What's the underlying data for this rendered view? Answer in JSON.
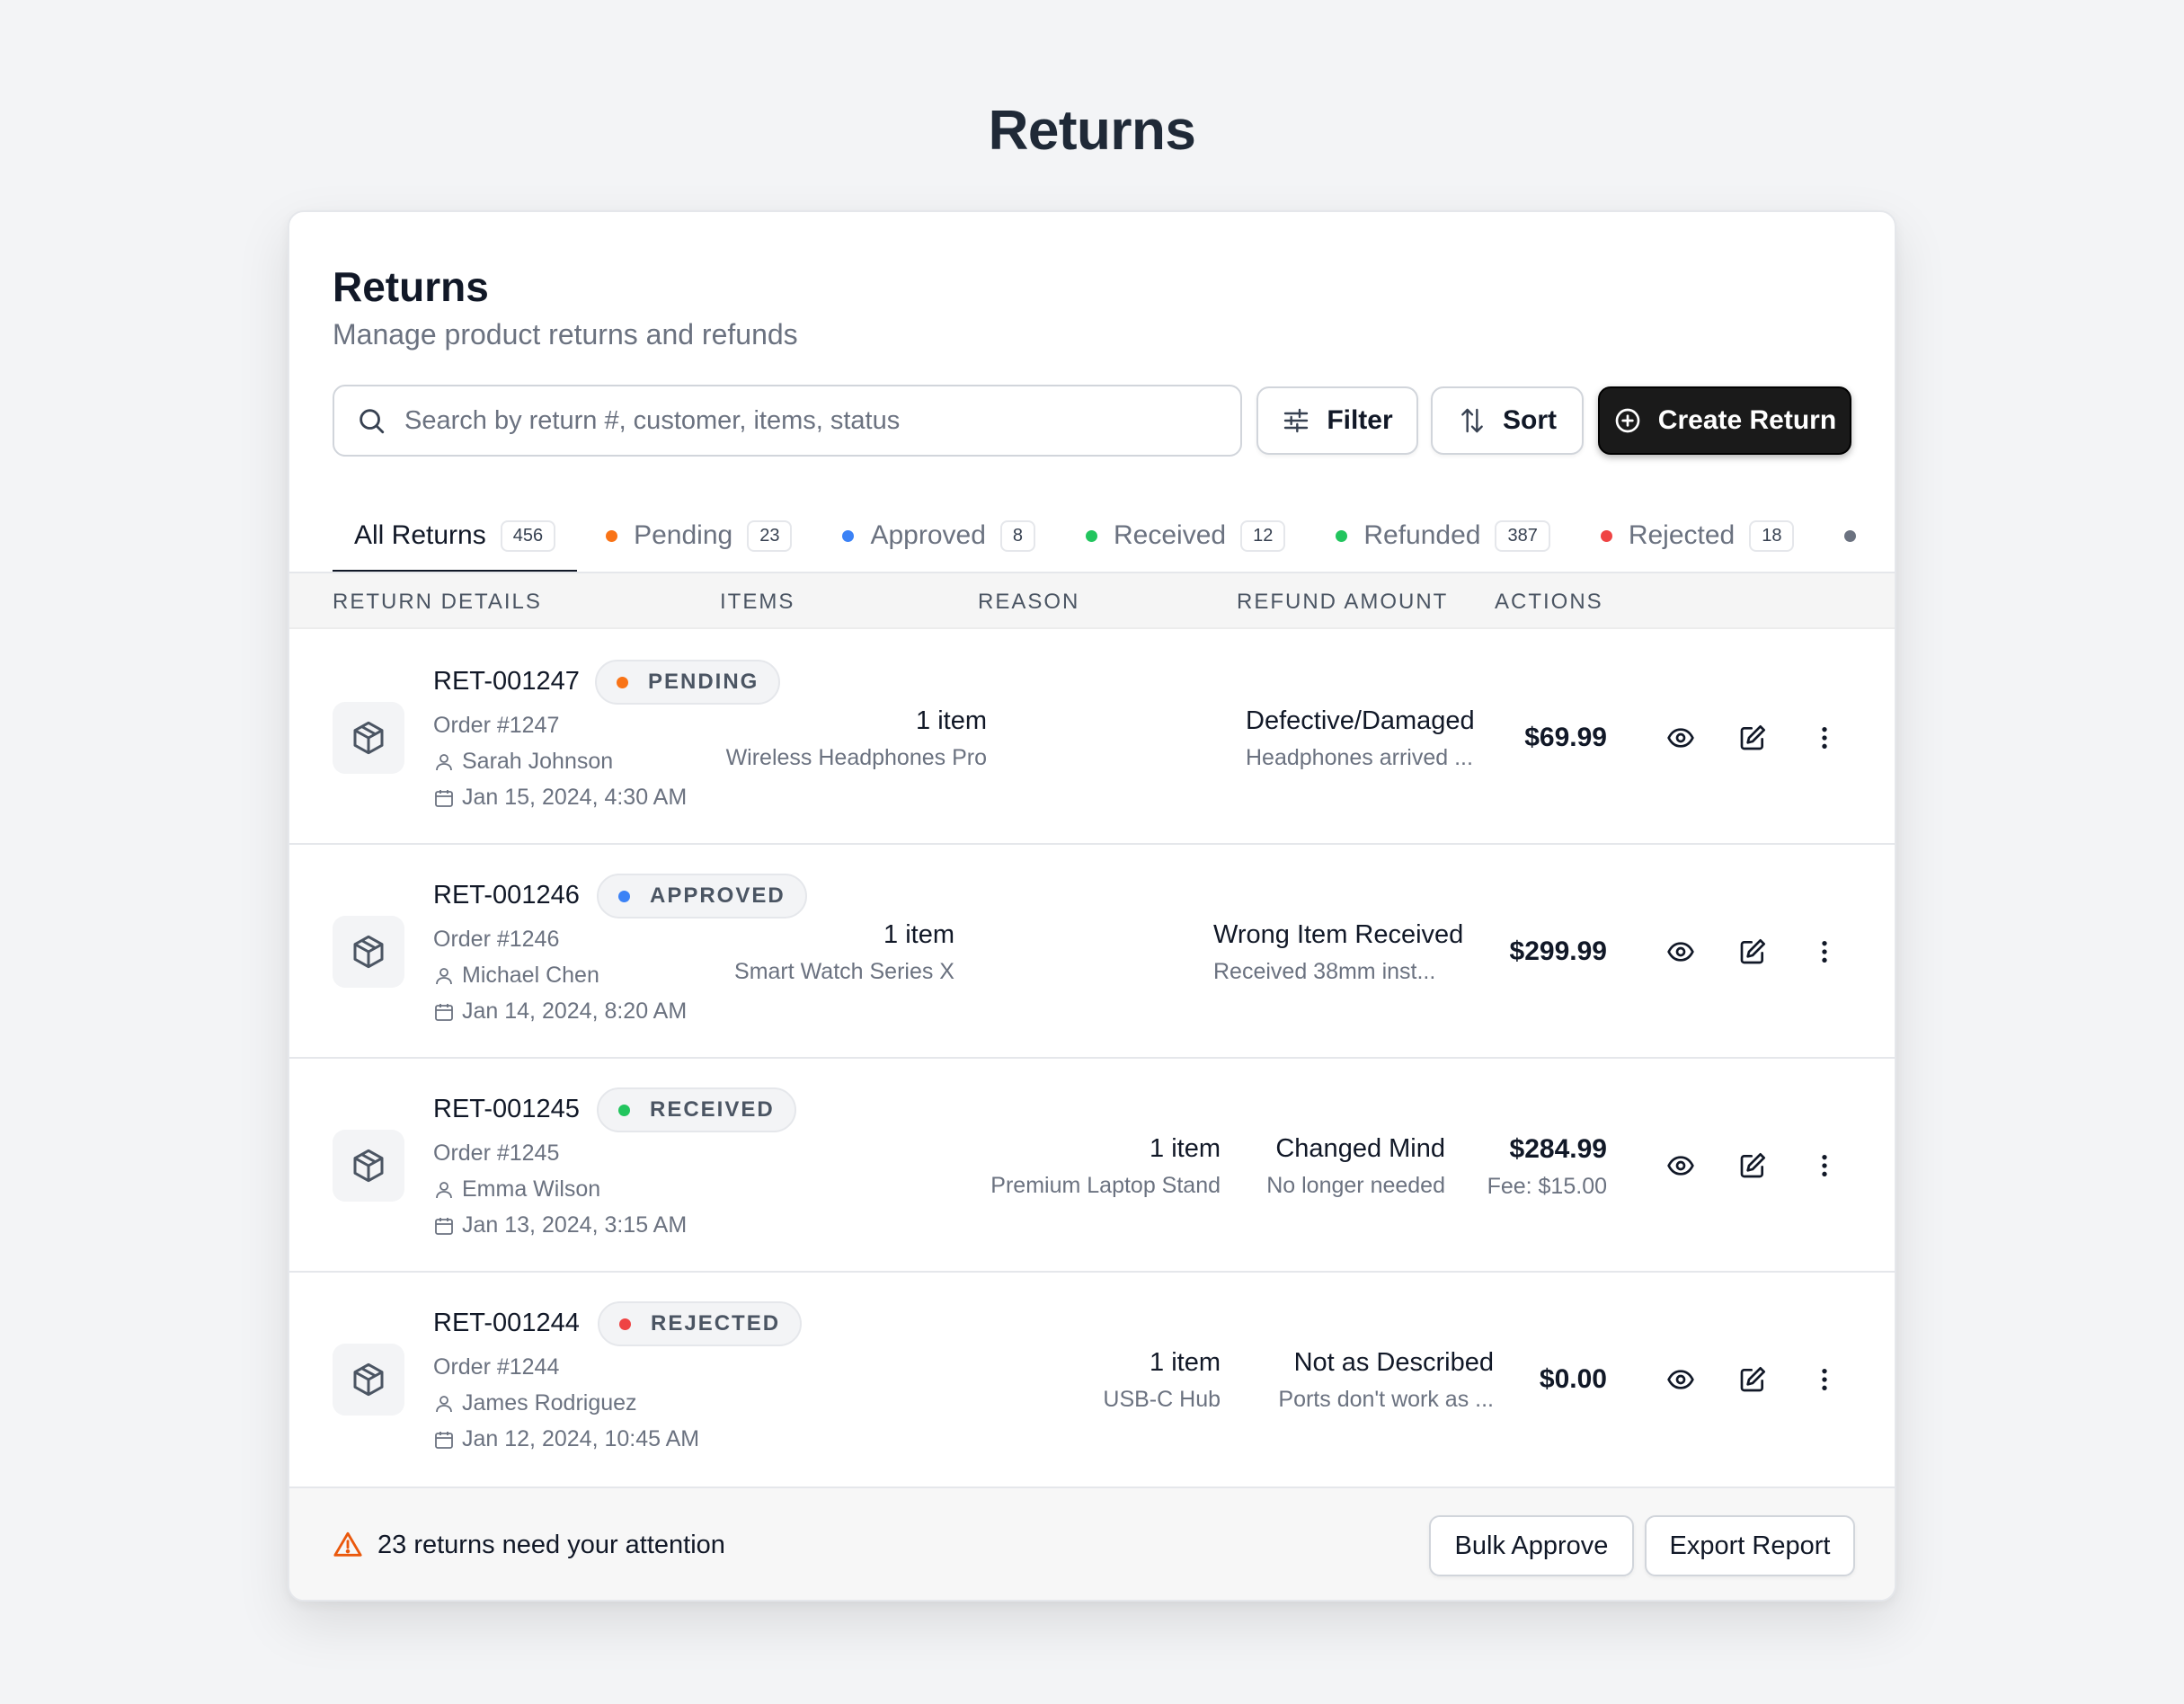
{
  "page": {
    "title": "Returns"
  },
  "card": {
    "title": "Returns",
    "subtitle": "Manage product returns and refunds"
  },
  "search": {
    "placeholder": "Search by return #, customer, items, status",
    "value": ""
  },
  "toolbar": {
    "filter_label": "Filter",
    "sort_label": "Sort",
    "create_label": "Create Return"
  },
  "tabs": [
    {
      "label": "All Returns",
      "count": "456",
      "active": true
    },
    {
      "label": "Pending",
      "count": "23",
      "color": "#f97316"
    },
    {
      "label": "Approved",
      "count": "8",
      "color": "#3b82f6"
    },
    {
      "label": "Received",
      "count": "12",
      "color": "#22c55e"
    },
    {
      "label": "Refunded",
      "count": "387",
      "color": "#22c55e"
    },
    {
      "label": "Rejected",
      "count": "18",
      "color": "#ef4444"
    }
  ],
  "table": {
    "columns": [
      "RETURN DETAILS",
      "ITEMS",
      "REASON",
      "REFUND AMOUNT",
      "ACTIONS"
    ],
    "rows": [
      {
        "id": "RET-001247",
        "status": "PENDING",
        "status_color": "#f97316",
        "order": "Order #1247",
        "customer": "Sarah Johnson",
        "date": "Jan 15, 2024, 4:30 AM",
        "items_count": "1 item",
        "item_name": "Wireless Headphones Pro",
        "reason": "Defective/Damaged",
        "reason_detail": "Headphones arrived ...",
        "amount": "$69.99",
        "fee": ""
      },
      {
        "id": "RET-001246",
        "status": "APPROVED",
        "status_color": "#3b82f6",
        "order": "Order #1246",
        "customer": "Michael Chen",
        "date": "Jan 14, 2024, 8:20 AM",
        "items_count": "1 item",
        "item_name": "Smart Watch Series X",
        "reason": "Wrong Item Received",
        "reason_detail": "Received 38mm inst...",
        "amount": "$299.99",
        "fee": ""
      },
      {
        "id": "RET-001245",
        "status": "RECEIVED",
        "status_color": "#22c55e",
        "order": "Order #1245",
        "customer": "Emma Wilson",
        "date": "Jan 13, 2024, 3:15 AM",
        "items_count": "1 item",
        "item_name": "Premium Laptop Stand",
        "reason": "Changed Mind",
        "reason_detail": "No longer needed",
        "amount": "$284.99",
        "fee": "Fee: $15.00"
      },
      {
        "id": "RET-001244",
        "status": "REJECTED",
        "status_color": "#ef4444",
        "order": "Order #1244",
        "customer": "James Rodriguez",
        "date": "Jan 12, 2024, 10:45 AM",
        "items_count": "1 item",
        "item_name": "USB-C Hub",
        "reason": "Not as Described",
        "reason_detail": "Ports don't work as ...",
        "amount": "$0.00",
        "fee": ""
      }
    ]
  },
  "footer": {
    "attention_text": "23 returns need your attention",
    "bulk_approve_label": "Bulk Approve",
    "export_label": "Export Report"
  },
  "icons": {
    "search": "search-icon",
    "filter": "sliders-icon",
    "sort": "sort-arrows-icon",
    "create": "plus-circle-icon",
    "package": "package-icon",
    "user": "user-icon",
    "calendar": "calendar-icon",
    "view": "eye-icon",
    "edit": "edit-icon",
    "more": "more-vertical-icon",
    "warning": "warning-triangle-icon"
  }
}
